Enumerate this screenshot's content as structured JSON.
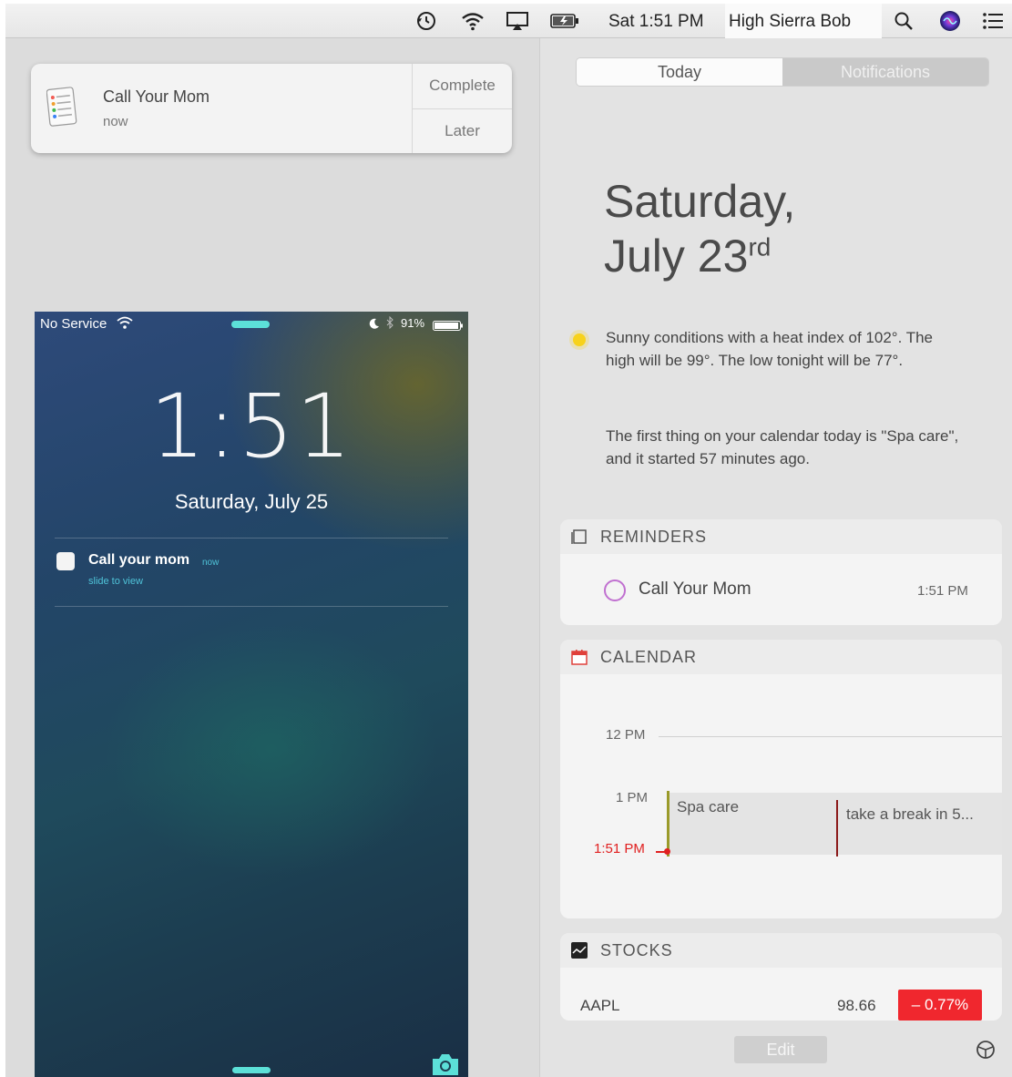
{
  "menubar": {
    "clock": "Sat 1:51 PM",
    "user": "High Sierra Bob",
    "icons": [
      "time-machine-icon",
      "wifi-icon",
      "airplay-icon",
      "battery-icon",
      "search-icon",
      "siri-icon",
      "notification-center-icon"
    ]
  },
  "banner": {
    "title": "Call Your Mom",
    "time": "now",
    "complete_label": "Complete",
    "later_label": "Later"
  },
  "phone": {
    "carrier": "No Service",
    "battery": "91%",
    "time": "1:51",
    "date": "Saturday, July 25",
    "notification": {
      "title": "Call your mom",
      "time": "now",
      "hint": "slide to view"
    }
  },
  "panel": {
    "tabs": {
      "today": "Today",
      "notifications": "Notifications"
    },
    "date_line1": "Saturday,",
    "date_line2": "July 23",
    "date_suffix": "rd",
    "weather": "Sunny conditions with a heat index of 102°. The high will be 99°. The low tonight will be 77°.",
    "calendar_summary": "The first thing on your calendar today is \"Spa care\", and it started 57 minutes ago.",
    "reminders": {
      "header": "REMINDERS",
      "item_title": "Call Your Mom",
      "item_time": "1:51 PM"
    },
    "calendar": {
      "header": "CALENDAR",
      "label_12pm": "12 PM",
      "label_1pm": "1 PM",
      "now_label": "1:51 PM",
      "event1": "Spa care",
      "event2": "take a break in 5..."
    },
    "stocks": {
      "header": "STOCKS",
      "symbol": "AAPL",
      "price": "98.66",
      "change": "– 0.77%",
      "change_color": "#f0272e"
    },
    "edit_label": "Edit"
  }
}
